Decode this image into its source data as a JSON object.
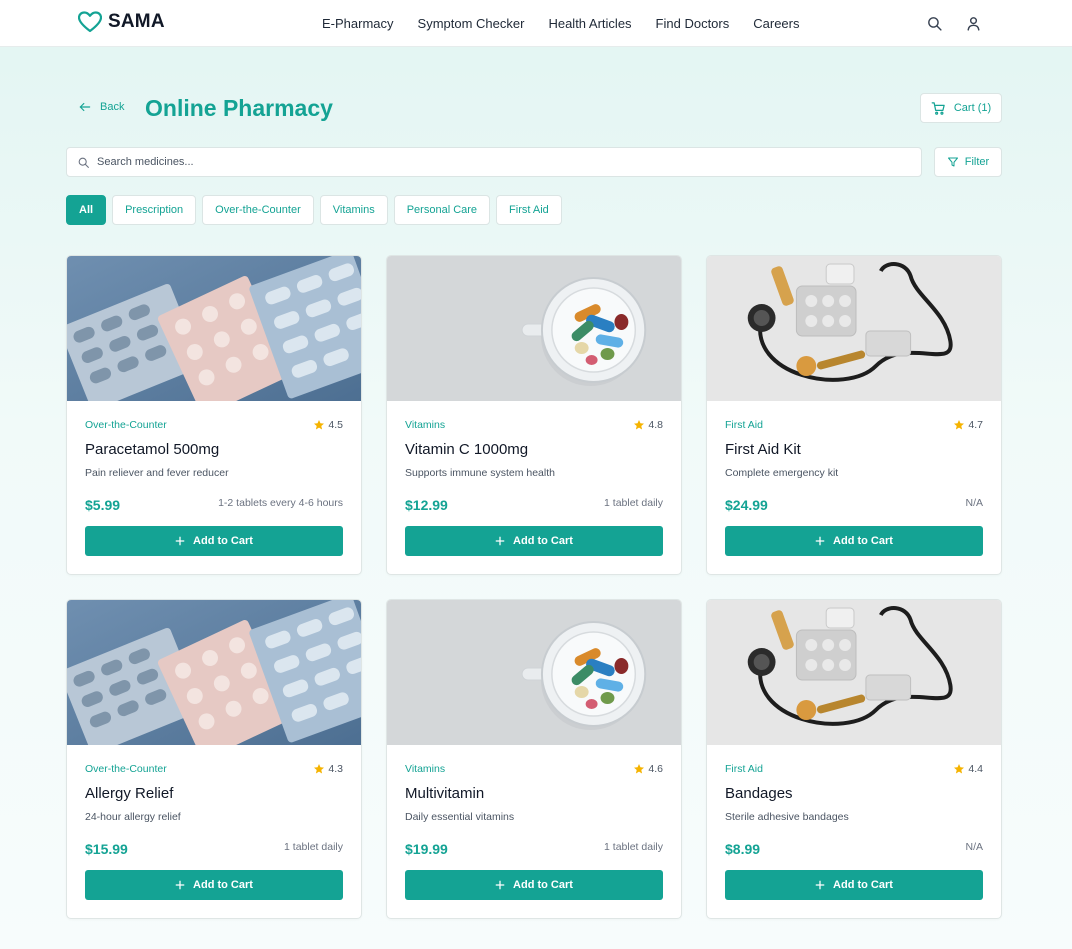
{
  "brand": {
    "name": "SAMA",
    "icon": "heart-icon"
  },
  "nav": {
    "links": [
      "E-Pharmacy",
      "Symptom Checker",
      "Health Articles",
      "Find Doctors",
      "Careers"
    ],
    "icons": [
      "search-icon",
      "user-icon"
    ]
  },
  "header": {
    "back_label": "Back",
    "title": "Online Pharmacy",
    "cart_label": "Cart (1)"
  },
  "search": {
    "placeholder": "Search medicines..."
  },
  "filter_label": "Filter",
  "categories": [
    {
      "label": "All",
      "active": true
    },
    {
      "label": "Prescription",
      "active": false
    },
    {
      "label": "Over-the-Counter",
      "active": false
    },
    {
      "label": "Vitamins",
      "active": false
    },
    {
      "label": "Personal Care",
      "active": false
    },
    {
      "label": "First Aid",
      "active": false
    }
  ],
  "products": [
    {
      "category": "Over-the-Counter",
      "rating": "4.5",
      "name": "Paracetamol 500mg",
      "description": "Pain reliever and fever reducer",
      "price": "$5.99",
      "dosage": "1-2 tablets every 4-6 hours",
      "image": "blister-packs-image",
      "button": "Add to Cart"
    },
    {
      "category": "Vitamins",
      "rating": "4.8",
      "name": "Vitamin C 1000mg",
      "description": "Supports immune system health",
      "price": "$12.99",
      "dosage": "1 tablet daily",
      "image": "pill-cup-image",
      "button": "Add to Cart"
    },
    {
      "category": "First Aid",
      "rating": "4.7",
      "name": "First Aid Kit",
      "description": "Complete emergency kit",
      "price": "$24.99",
      "dosage": "N/A",
      "image": "stethoscope-image",
      "button": "Add to Cart"
    },
    {
      "category": "Over-the-Counter",
      "rating": "4.3",
      "name": "Allergy Relief",
      "description": "24-hour allergy relief",
      "price": "$15.99",
      "dosage": "1 tablet daily",
      "image": "blister-packs-image",
      "button": "Add to Cart"
    },
    {
      "category": "Vitamins",
      "rating": "4.6",
      "name": "Multivitamin",
      "description": "Daily essential vitamins",
      "price": "$19.99",
      "dosage": "1 tablet daily",
      "image": "pill-cup-image",
      "button": "Add to Cart"
    },
    {
      "category": "First Aid",
      "rating": "4.4",
      "name": "Bandages",
      "description": "Sterile adhesive bandages",
      "price": "$8.99",
      "dosage": "N/A",
      "image": "stethoscope-image",
      "button": "Add to Cart"
    }
  ],
  "colors": {
    "accent": "#14a394",
    "star": "#f5b300",
    "background": "#e2f5f2"
  }
}
